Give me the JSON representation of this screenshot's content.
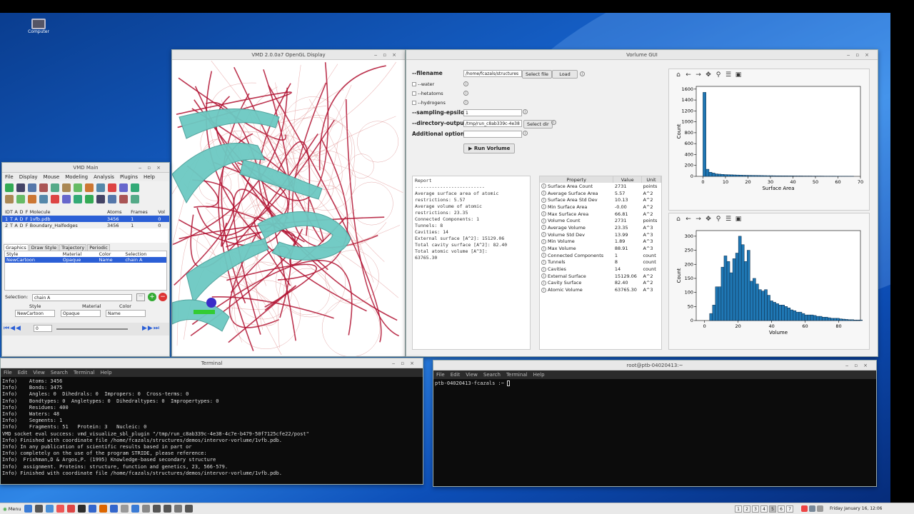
{
  "desktop": {
    "computer_label": "Computer"
  },
  "gl": {
    "title": "VMD 2.0.0a7 OpenGL Display"
  },
  "vmd_main": {
    "title": "VMD Main",
    "menu": [
      "File",
      "Display",
      "Mouse",
      "Modeling",
      "Analysis",
      "Plugins",
      "Help"
    ],
    "headers": {
      "id": "ID",
      "t": "T",
      "a": "A",
      "d": "D",
      "f": "F",
      "molecule": "Molecule",
      "atoms": "Atoms",
      "frames": "Frames",
      "vol": "Vol"
    },
    "molecules": [
      {
        "id": "1",
        "t": "T",
        "a": "A",
        "d": "D",
        "f": "F",
        "name": "1vfb.pdb",
        "atoms": "3456",
        "frames": "1",
        "vol": "0"
      },
      {
        "id": "2",
        "t": "T",
        "a": "A",
        "d": "D",
        "f": "F",
        "name": "Boundary_Halfedges",
        "atoms": "3456",
        "frames": "1",
        "vol": "0"
      }
    ],
    "tabs": [
      "Graphics",
      "Draw Style",
      "Trajectory",
      "Periodic"
    ],
    "rep_headers": {
      "style": "Style",
      "material": "Material",
      "color": "Color",
      "selection": "Selection"
    },
    "rep": {
      "style": "NewCartoon",
      "material": "Opaque",
      "color": "Name",
      "selection": "chain A"
    },
    "selection_label": "Selection:",
    "selection_value": "chain A",
    "style_label": "Style",
    "material_label": "Material",
    "color_label": "Color",
    "style_value": "NewCartoon",
    "material_value": "Opaque",
    "color_value": "Name",
    "frame_value": "0"
  },
  "vorlume": {
    "title": "Vorlume GUI",
    "filename_label": "--filename",
    "filename_value": "/home/fcazals/structures",
    "select_file": "Select file",
    "load": "Load",
    "water": "--water",
    "hetatoms": "--hetatoms",
    "hydrogens": "--hydrogens",
    "eps_label": "--sampling-epsilon",
    "eps_value": "1",
    "dir_label": "--directory-output",
    "dir_value": "/tmp/run_c8ab339c-4e38",
    "select_dir": "Select dir",
    "opts_label": "Additional options",
    "run": "▶ Run Vorlume",
    "report_title": "Report",
    "report_lines": [
      "-------------------------",
      "Average surface area of atomic",
      "restrictions: 5.57",
      "Average volume of atomic",
      "restrictions: 23.35",
      "Connected Components: 1",
      "Tunnels: 8",
      "Cavities: 14",
      "External surface [A^2]: 15129.06",
      "Total cavity surface [A^2]: 82.40",
      "Total atomic volume [A^3]:",
      "63765.30"
    ],
    "table_headers": {
      "property": "Property",
      "value": "Value",
      "unit": "Unit"
    },
    "props": [
      {
        "name": "Surface Area Count",
        "value": "2731",
        "unit": "points"
      },
      {
        "name": "Average Surface Area",
        "value": "5.57",
        "unit": "A^2"
      },
      {
        "name": "Surface Area Std Dev",
        "value": "10.13",
        "unit": "A^2"
      },
      {
        "name": "Min Surface Area",
        "value": "-0.00",
        "unit": "A^2"
      },
      {
        "name": "Max Surface Area",
        "value": "66.81",
        "unit": "A^2"
      },
      {
        "name": "Volume Count",
        "value": "2731",
        "unit": "points"
      },
      {
        "name": "Average Volume",
        "value": "23.35",
        "unit": "A^3"
      },
      {
        "name": "Volume Std Dev",
        "value": "13.99",
        "unit": "A^3"
      },
      {
        "name": "Min Volume",
        "value": "1.89",
        "unit": "A^3"
      },
      {
        "name": "Max Volume",
        "value": "88.91",
        "unit": "A^3"
      },
      {
        "name": "Connected Components",
        "value": "1",
        "unit": "count"
      },
      {
        "name": "Tunnels",
        "value": "8",
        "unit": "count"
      },
      {
        "name": "Cavities",
        "value": "14",
        "unit": "count"
      },
      {
        "name": "External Surface",
        "value": "15129.06",
        "unit": "A^2"
      },
      {
        "name": "Cavity Surface",
        "value": "82.40",
        "unit": "A^2"
      },
      {
        "name": "Atomic Volume",
        "value": "63765.30",
        "unit": "A^3"
      }
    ]
  },
  "chart_data": [
    {
      "type": "bar",
      "xlabel": "Surface Area",
      "ylabel": "Count",
      "xlim": [
        -3,
        70
      ],
      "ylim": [
        0,
        1650
      ],
      "xticks": [
        "0",
        "10",
        "20",
        "30",
        "40",
        "50",
        "60",
        "70"
      ],
      "yticks": [
        "0",
        "200",
        "400",
        "600",
        "800",
        "1000",
        "1200",
        "1400",
        "1600"
      ],
      "bin_start": 0,
      "bin_width": 1.34,
      "values": [
        1540,
        130,
        75,
        60,
        45,
        40,
        36,
        32,
        30,
        28,
        26,
        24,
        22,
        20,
        19,
        18,
        17,
        16,
        15,
        14,
        13,
        12,
        12,
        11,
        10,
        10,
        9,
        9,
        8,
        8,
        7,
        7,
        7,
        6,
        6,
        6,
        5,
        5,
        5,
        5,
        4,
        4,
        4,
        4,
        3,
        3,
        3,
        3,
        2,
        2
      ]
    },
    {
      "type": "bar",
      "xlabel": "Volume",
      "ylabel": "Count",
      "xlim": [
        -5,
        93
      ],
      "ylim": [
        0,
        320
      ],
      "xticks": [
        "0",
        "20",
        "40",
        "60",
        "80"
      ],
      "yticks": [
        "0",
        "50",
        "100",
        "150",
        "200",
        "250",
        "300"
      ],
      "bin_start": 3,
      "bin_width": 1.72,
      "values": [
        25,
        55,
        120,
        120,
        190,
        230,
        210,
        170,
        220,
        240,
        300,
        270,
        210,
        250,
        140,
        150,
        130,
        110,
        105,
        110,
        90,
        70,
        65,
        60,
        55,
        55,
        50,
        45,
        38,
        35,
        30,
        30,
        25,
        20,
        20,
        20,
        18,
        15,
        15,
        12,
        12,
        10,
        8,
        8,
        8,
        6,
        5,
        4,
        3,
        3,
        2,
        2,
        2
      ]
    }
  ],
  "terminal": {
    "title": "Terminal",
    "menu": [
      "File",
      "Edit",
      "View",
      "Search",
      "Terminal",
      "Help"
    ],
    "lines": [
      "Info)    Atoms: 3456",
      "Info)    Bonds: 3475",
      "Info)    Angles: 0  Dihedrals: 0  Impropers: 0  Cross-terms: 0",
      "Info)    Bondtypes: 0  Angletypes: 0  Dihedraltypes: 0  Impropertypes: 0",
      "Info)    Residues: 400",
      "Info)    Waters: 48",
      "Info)    Segments: 1",
      "Info)    Fragments: 51   Protein: 3   Nucleic: 0",
      "VMD socket eval success: vmd_visualize_sbl_plugin \"/tmp/run_c8ab339c-4e38-4c7e-b479-50f7125cfe22/post\"",
      "Info) Finished with coordinate file /home/fcazals/structures/demos/intervor-vorlume/1vfb.pdb.",
      "Info) In any publication of scientific results based in part or",
      "Info) completely on the use of the program STRIDE, please reference:",
      "Info)  Frishman,D & Argos,P. (1995) Knowledge-based secondary structure",
      "Info)  assignment. Proteins: structure, function and genetics, 23, 566-579.",
      "Info) Finished with coordinate file /home/fcazals/structures/demos/intervor-vorlume/1vfb.pdb."
    ]
  },
  "terminal2": {
    "title": "root@ptb-04020413:~",
    "menu": [
      "File",
      "Edit",
      "View",
      "Search",
      "Terminal",
      "Help"
    ],
    "prompt": "ptb-04020413-fcazals :~ "
  },
  "taskbar": {
    "menu": "Menu",
    "workspaces": [
      "1",
      "2",
      "3",
      "4",
      "5",
      "6",
      "7"
    ],
    "clock": "Friday January 16, 12:06"
  }
}
